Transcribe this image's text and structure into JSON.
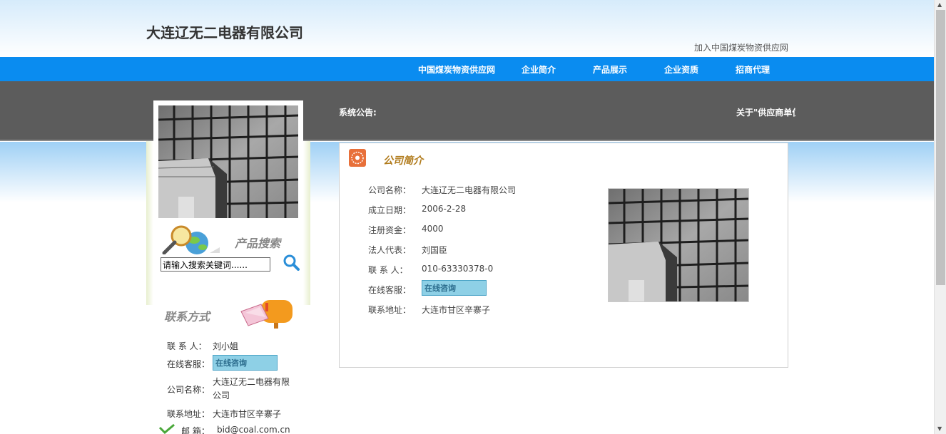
{
  "header": {
    "site_title": "大连辽无二电器有限公司",
    "join_link": "加入中国煤炭物资供应网"
  },
  "nav": {
    "items": [
      "中国煤炭物资供应网",
      "企业简介",
      "产品展示",
      "企业资质",
      "招商代理"
    ]
  },
  "notice": {
    "label": "系统公告:",
    "text": "关于\"供应商单位"
  },
  "sidebar": {
    "product_search_title": "产品搜索",
    "search_placeholder": "请输入搜索关键词......",
    "contact_title": "联系方式",
    "contact": {
      "person_label": "联 系 人：",
      "person_value": "刘小姐",
      "service_label": "在线客服：",
      "service_badge": "在线咨询",
      "company_label": "公司名称：",
      "company_value": "大连辽无二电器有限公司",
      "address_label": "联系地址：",
      "address_value": "大连市甘区辛寨子",
      "email_label": "邮 箱：",
      "email_value": "bid@coal.com.cn"
    }
  },
  "main": {
    "section_title": "公司简介",
    "fields": [
      {
        "label": "公司名称：",
        "value": "大连辽无二电器有限公司"
      },
      {
        "label": "成立日期：",
        "value": "2006-2-28"
      },
      {
        "label": "注册资金：",
        "value": "4000"
      },
      {
        "label": "法人代表：",
        "value": "刘国臣"
      },
      {
        "label": "联 系 人：",
        "value": "010-63330378-0"
      },
      {
        "label": "在线客服：",
        "value": "在线咨询"
      },
      {
        "label": "联系地址：",
        "value": "大连市甘区辛寨子"
      }
    ]
  },
  "colors": {
    "nav_blue": "#0a8cf0",
    "notice_gray": "#5c5c5c",
    "section_title": "#b07a1a",
    "chat_badge": "#8ed0e6"
  }
}
